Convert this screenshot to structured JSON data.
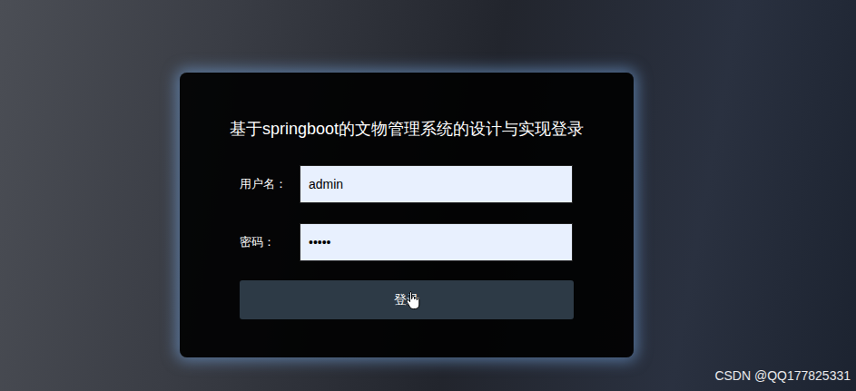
{
  "page": {
    "title": "基于springboot的文物管理系统的设计与实现登录"
  },
  "form": {
    "fields": [
      {
        "label": "用户名：",
        "value": "admin"
      },
      {
        "label": "密码：",
        "value": "•••••"
      }
    ],
    "submit": "登录"
  },
  "watermark": "CSDN @QQ177825331"
}
